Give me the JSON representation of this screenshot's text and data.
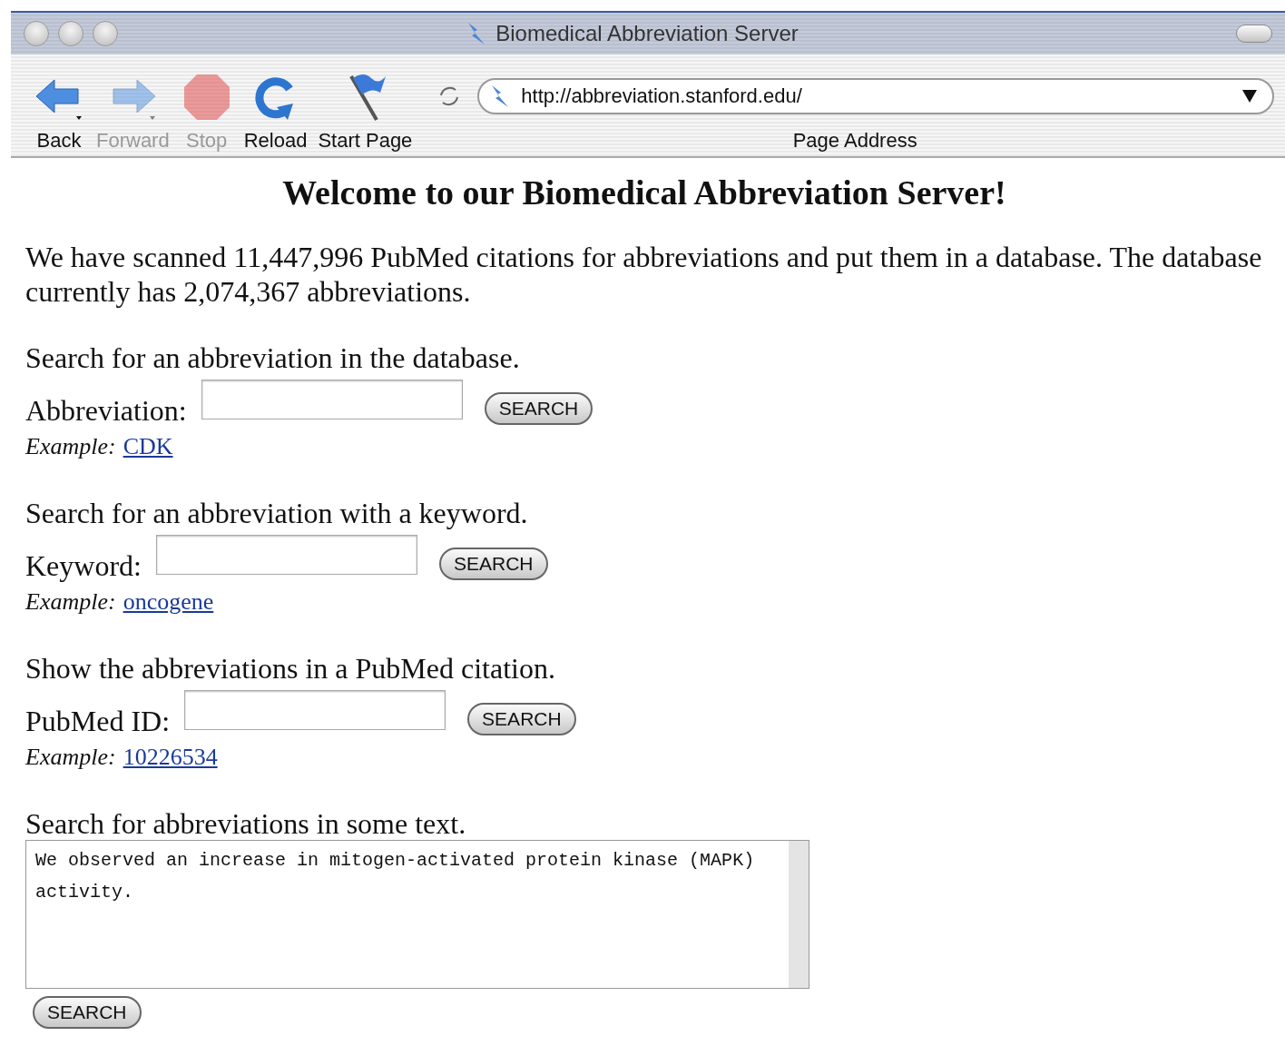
{
  "window": {
    "title": "Biomedical Abbreviation Server"
  },
  "toolbar": {
    "buttons": [
      {
        "kind": "back",
        "label": "Back",
        "disabled": false
      },
      {
        "kind": "forward",
        "label": "Forward",
        "disabled": true
      },
      {
        "kind": "stop",
        "label": "Stop",
        "disabled": true
      },
      {
        "kind": "reload",
        "label": "Reload",
        "disabled": false
      },
      {
        "kind": "start",
        "label": "Start Page",
        "disabled": false
      }
    ],
    "address": {
      "value": "http://abbreviation.stanford.edu/",
      "label": "Page Address"
    }
  },
  "page": {
    "heading": "Welcome to our Biomedical Abbreviation Server!",
    "intro": "We have scanned 11,447,996 PubMed citations for abbreviations and put them in a database. The database currently has 2,074,367 abbreviations.",
    "forms": [
      {
        "kind": "field",
        "title": "Search for an abbreviation in the database.",
        "label": "Abbreviation:",
        "button": "SEARCH",
        "example_label": "Example:",
        "example_link": "CDK"
      },
      {
        "kind": "field",
        "title": "Search for an abbreviation with a keyword.",
        "label": "Keyword:",
        "button": "SEARCH",
        "example_label": "Example:",
        "example_link": "oncogene"
      },
      {
        "kind": "field",
        "title": "Show the abbreviations in a PubMed citation.",
        "label": "PubMed ID:",
        "button": "SEARCH",
        "example_label": "Example:",
        "example_link": "10226534"
      },
      {
        "kind": "textarea",
        "title": "Search for abbreviations in some text.",
        "value": "We observed an increase in mitogen-activated protein kinase (MAPK) activity.",
        "button": "SEARCH"
      }
    ]
  }
}
